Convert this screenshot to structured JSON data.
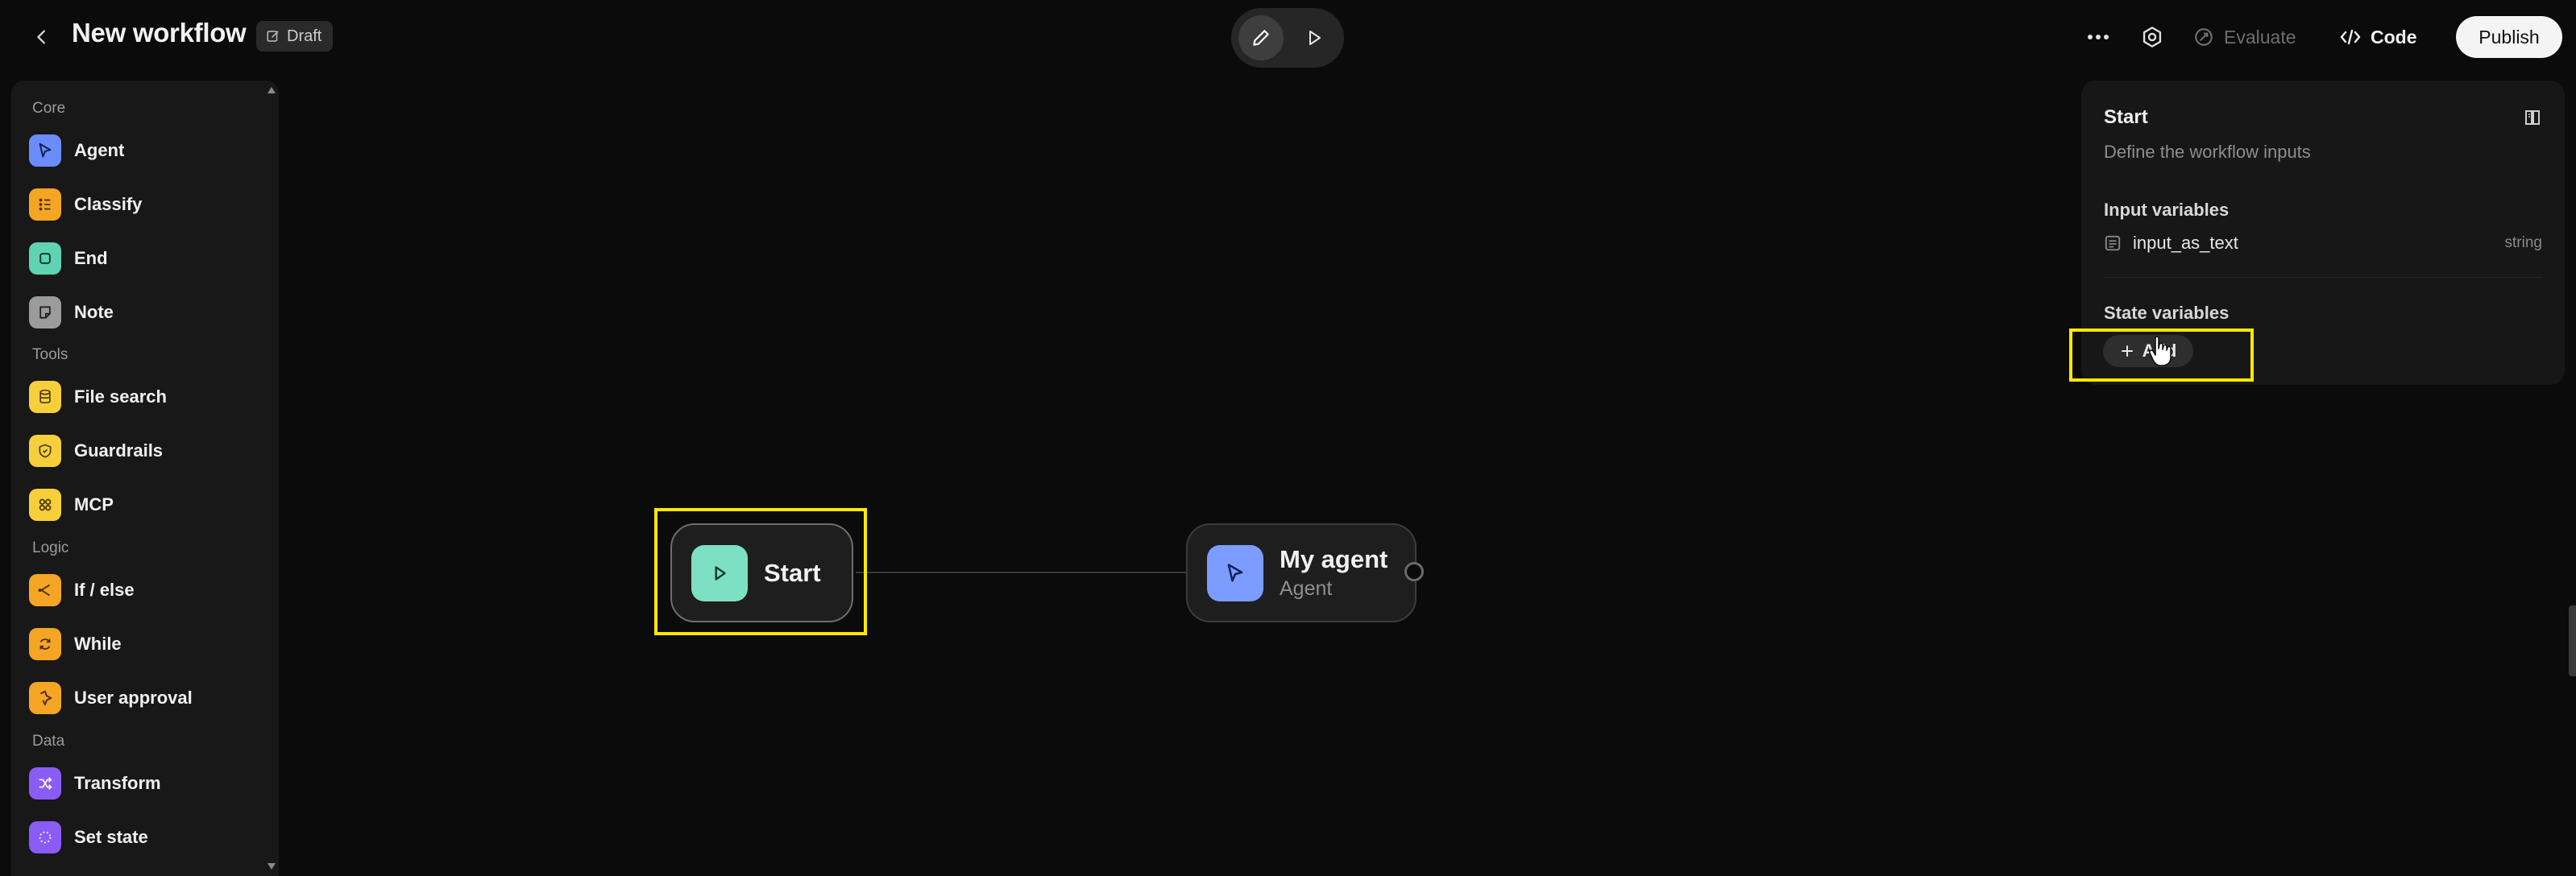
{
  "header": {
    "title": "New workflow",
    "draft_badge": "Draft",
    "evaluate_label": "Evaluate",
    "code_label": "Code",
    "publish_label": "Publish"
  },
  "sidebar": {
    "sections": [
      {
        "title": "Core",
        "items": [
          {
            "label": "Agent",
            "icon": "cursor-arrow-icon",
            "color": "#6b8cff"
          },
          {
            "label": "Classify",
            "icon": "classify-icon",
            "color": "#f5a524"
          },
          {
            "label": "End",
            "icon": "stop-square-icon",
            "color": "#5fd3b3"
          },
          {
            "label": "Note",
            "icon": "note-icon",
            "color": "#9b9b9b"
          }
        ]
      },
      {
        "title": "Tools",
        "items": [
          {
            "label": "File search",
            "icon": "database-icon",
            "color": "#f7cf3a"
          },
          {
            "label": "Guardrails",
            "icon": "shield-icon",
            "color": "#f7cf3a"
          },
          {
            "label": "MCP",
            "icon": "mcp-icon",
            "color": "#f7cf3a"
          }
        ]
      },
      {
        "title": "Logic",
        "items": [
          {
            "label": "If / else",
            "icon": "branch-icon",
            "color": "#f5a524"
          },
          {
            "label": "While",
            "icon": "loop-icon",
            "color": "#f5a524"
          },
          {
            "label": "User approval",
            "icon": "approval-icon",
            "color": "#f5a524"
          }
        ]
      },
      {
        "title": "Data",
        "items": [
          {
            "label": "Transform",
            "icon": "shuffle-icon",
            "color": "#8a5cf6"
          },
          {
            "label": "Set state",
            "icon": "dotted-circle-icon",
            "color": "#8a5cf6"
          }
        ]
      }
    ]
  },
  "canvas": {
    "start_node": {
      "title": "Start",
      "color": "#7ee0c3"
    },
    "agent_node": {
      "title": "My agent",
      "subtitle": "Agent",
      "color": "#7c9cff"
    }
  },
  "panel": {
    "title": "Start",
    "description": "Define the workflow inputs",
    "input_variables_label": "Input variables",
    "input_variables": [
      {
        "name": "input_as_text",
        "type": "string"
      }
    ],
    "state_variables_label": "State variables",
    "add_label": "Add"
  },
  "colors": {
    "highlight": "#ffe800",
    "background": "#0b0b0b",
    "publish_bg": "#f4f4f4"
  }
}
